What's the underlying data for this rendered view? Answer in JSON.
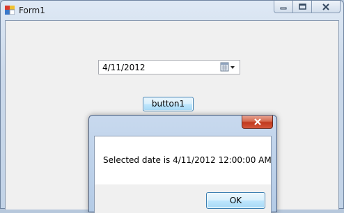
{
  "window": {
    "title": "Form1"
  },
  "datepicker": {
    "value": "4/11/2012",
    "icon": "calendar-dropdown-icon"
  },
  "button1": {
    "label": "button1"
  },
  "messagebox": {
    "message": "Selected date is 4/11/2012 12:00:00 AM",
    "ok_label": "OK",
    "close_icon": "close-icon"
  },
  "colors": {
    "close_button": "#c0391e",
    "button_border": "#3c7fb1",
    "client_background": "#f0f0f0"
  }
}
